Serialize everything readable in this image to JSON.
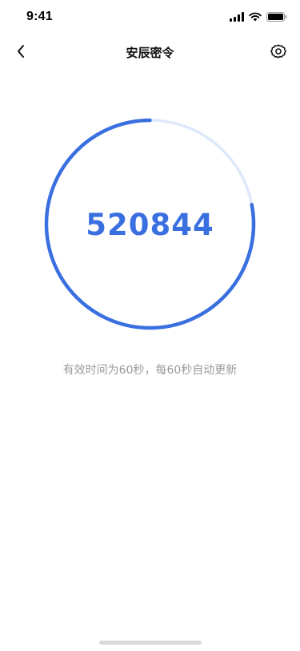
{
  "status_bar": {
    "time": "9:41",
    "signal_icon": "cellular-signal-icon",
    "wifi_icon": "wifi-icon",
    "battery_icon": "battery-icon"
  },
  "nav": {
    "title": "安辰密令",
    "back_icon": "chevron-left-icon",
    "settings_icon": "gear-icon"
  },
  "token": {
    "code": "520844",
    "remaining_fraction": 0.78,
    "colors": {
      "accent": "#3a6fe0",
      "track": "#dde8fb"
    }
  },
  "hint": "有效时间为60秒，每60秒自动更新"
}
